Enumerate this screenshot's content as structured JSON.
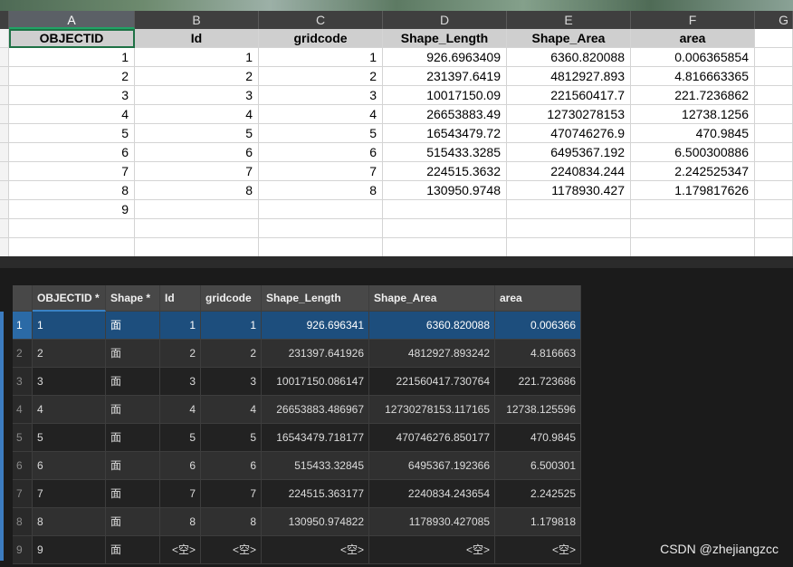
{
  "spreadsheet": {
    "column_letters": [
      "A",
      "B",
      "C",
      "D",
      "E",
      "F",
      "G"
    ],
    "headers": [
      "OBJECTID",
      "Id",
      "gridcode",
      "Shape_Length",
      "Shape_Area",
      "area"
    ],
    "rows": [
      [
        "1",
        "1",
        "1",
        "926.6963409",
        "6360.820088",
        "0.006365854"
      ],
      [
        "2",
        "2",
        "2",
        "231397.6419",
        "4812927.893",
        "4.816663365"
      ],
      [
        "3",
        "3",
        "3",
        "10017150.09",
        "221560417.7",
        "221.7236862"
      ],
      [
        "4",
        "4",
        "4",
        "26653883.49",
        "12730278153",
        "12738.1256"
      ],
      [
        "5",
        "5",
        "5",
        "16543479.72",
        "470746276.9",
        "470.9845"
      ],
      [
        "6",
        "6",
        "6",
        "515433.3285",
        "6495367.192",
        "6.500300886"
      ],
      [
        "7",
        "7",
        "7",
        "224515.3632",
        "2240834.244",
        "2.242525347"
      ],
      [
        "8",
        "8",
        "8",
        "130950.9748",
        "1178930.427",
        "1.179817626"
      ],
      [
        "9",
        "",
        "",
        "",
        "",
        ""
      ]
    ]
  },
  "attribute_table": {
    "headers": [
      "OBJECTID *",
      "Shape *",
      "Id",
      "gridcode",
      "Shape_Length",
      "Shape_Area",
      "area"
    ],
    "rows": [
      {
        "rownum": "1",
        "cells": [
          "1",
          "面",
          "1",
          "1",
          "926.696341",
          "6360.820088",
          "0.006366"
        ]
      },
      {
        "rownum": "2",
        "cells": [
          "2",
          "面",
          "2",
          "2",
          "231397.641926",
          "4812927.893242",
          "4.816663"
        ]
      },
      {
        "rownum": "3",
        "cells": [
          "3",
          "面",
          "3",
          "3",
          "10017150.086147",
          "221560417.730764",
          "221.723686"
        ]
      },
      {
        "rownum": "4",
        "cells": [
          "4",
          "面",
          "4",
          "4",
          "26653883.486967",
          "12730278153.117165",
          "12738.125596"
        ]
      },
      {
        "rownum": "5",
        "cells": [
          "5",
          "面",
          "5",
          "5",
          "16543479.718177",
          "470746276.850177",
          "470.9845"
        ]
      },
      {
        "rownum": "6",
        "cells": [
          "6",
          "面",
          "6",
          "6",
          "515433.32845",
          "6495367.192366",
          "6.500301"
        ]
      },
      {
        "rownum": "7",
        "cells": [
          "7",
          "面",
          "7",
          "7",
          "224515.363177",
          "2240834.243654",
          "2.242525"
        ]
      },
      {
        "rownum": "8",
        "cells": [
          "8",
          "面",
          "8",
          "8",
          "130950.974822",
          "1178930.427085",
          "1.179818"
        ]
      },
      {
        "rownum": "9",
        "cells": [
          "9",
          "面",
          "<空>",
          "<空>",
          "<空>",
          "<空>",
          "<空>"
        ]
      }
    ]
  },
  "watermark": "CSDN @zhejiangzcc",
  "colors": {
    "selection_blue": "#1d4e7d",
    "excel_green": "#21a366",
    "table_dark": "#222222"
  }
}
